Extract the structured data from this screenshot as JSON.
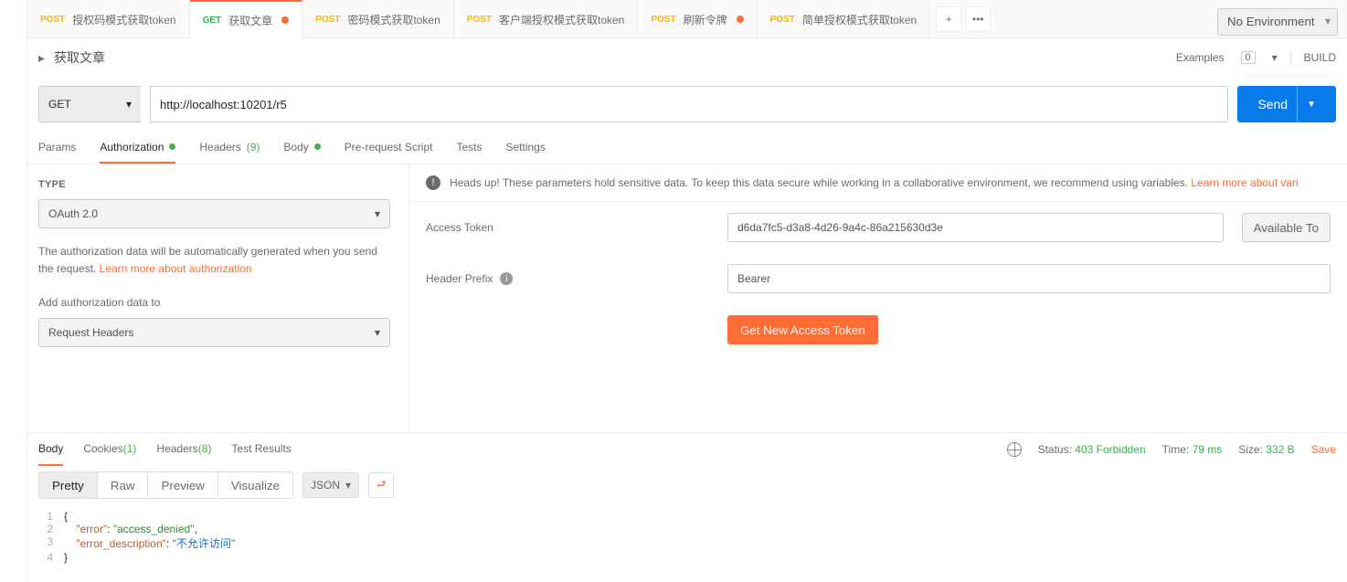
{
  "env": {
    "noEnv": "No Environment"
  },
  "tabs": [
    {
      "method": "POST",
      "cls": "post",
      "label": "授权码模式获取token"
    },
    {
      "method": "GET",
      "cls": "get",
      "label": "获取文章",
      "active": true,
      "dirty": true
    },
    {
      "method": "POST",
      "cls": "post",
      "label": "密码模式获取token"
    },
    {
      "method": "POST",
      "cls": "post",
      "label": "客户端授权模式获取token"
    },
    {
      "method": "POST",
      "cls": "post",
      "label": "刷新令牌",
      "dirty": true
    },
    {
      "method": "POST",
      "cls": "post",
      "label": "简单授权模式获取token"
    }
  ],
  "title": {
    "name": "获取文章",
    "examples": "Examples",
    "exCount": 0,
    "build": "BUILD"
  },
  "url": {
    "method": "GET",
    "value": "http://localhost:10201/r5",
    "send": "Send"
  },
  "reqTabs": {
    "params": "Params",
    "authorization": "Authorization",
    "headers": "Headers",
    "headersCount": "(9)",
    "body": "Body",
    "prs": "Pre-request Script",
    "tests": "Tests",
    "settings": "Settings"
  },
  "auth": {
    "typeLabel": "TYPE",
    "typeValue": "OAuth 2.0",
    "note": "The authorization data will be automatically generated when you send the request. ",
    "learn": "Learn more about authorization",
    "addTo": "Add authorization data to",
    "addToValue": "Request Headers",
    "headsUp": "Heads up! These parameters hold sensitive data. To keep this data secure while working in a collaborative environment, we recommend using variables. ",
    "headsUpLink": "Learn more about vari",
    "accessTokenLabel": "Access Token",
    "accessTokenValue": "d6da7fc5-d3a8-4d26-9a4c-86a215630d3e",
    "availableTokens": "Available To",
    "headerPrefixLabel": "Header Prefix",
    "headerPrefixValue": "Bearer",
    "getNew": "Get New Access Token"
  },
  "respTabs": {
    "body": "Body",
    "cookies": "Cookies",
    "cookiesCount": "(1)",
    "headers": "Headers",
    "headersCount": "(8)",
    "testResults": "Test Results"
  },
  "respMeta": {
    "statusLabel": "Status:",
    "status": "403 Forbidden",
    "timeLabel": "Time:",
    "time": "79 ms",
    "sizeLabel": "Size:",
    "size": "332 B",
    "save": "Save"
  },
  "viewSeg": {
    "pretty": "Pretty",
    "raw": "Raw",
    "preview": "Preview",
    "visualize": "Visualize",
    "fmt": "JSON"
  },
  "body": {
    "l1": "{",
    "l2k": "\"error\"",
    "l2v": "\"access_denied\"",
    "l3k": "\"error_description\"",
    "l3v": "\"不允许访问\"",
    "l4": "}"
  }
}
